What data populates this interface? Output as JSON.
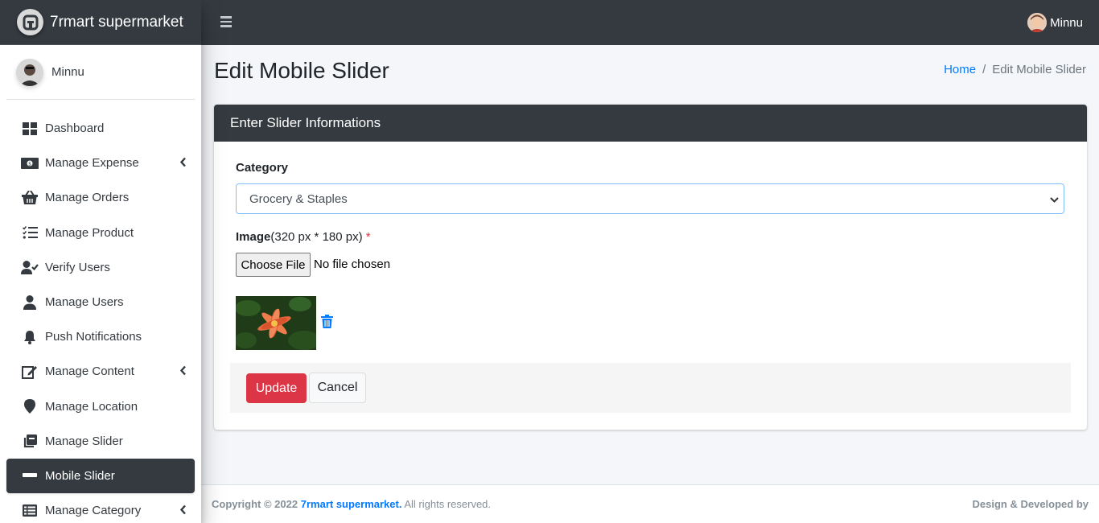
{
  "brand": {
    "name": "7rmart supermarket"
  },
  "sidebar": {
    "user_name": "Minnu",
    "items": [
      {
        "label": "Dashboard",
        "icon": "dashboard-icon"
      },
      {
        "label": "Manage Expense",
        "icon": "money-icon"
      },
      {
        "label": "Manage Orders",
        "icon": "basket-icon"
      },
      {
        "label": "Manage Product",
        "icon": "tasks-icon"
      },
      {
        "label": "Verify Users",
        "icon": "user-check-icon"
      },
      {
        "label": "Manage Users",
        "icon": "user-icon"
      },
      {
        "label": "Push Notifications",
        "icon": "bell-icon"
      },
      {
        "label": "Manage Content",
        "icon": "edit-icon"
      },
      {
        "label": "Manage Location",
        "icon": "map-marker-icon"
      },
      {
        "label": "Manage Slider",
        "icon": "clone-icon"
      },
      {
        "label": "Mobile Slider",
        "icon": "minus-icon"
      },
      {
        "label": "Manage Category",
        "icon": "list-icon"
      }
    ]
  },
  "topbar": {
    "user_name": "Minnu"
  },
  "header": {
    "title": "Edit Mobile Slider",
    "breadcrumb": {
      "home": "Home",
      "separator": "/",
      "current": "Edit Mobile Slider"
    }
  },
  "form": {
    "card_title": "Enter Slider Informations",
    "category_label": "Category",
    "category_value": "Grocery & Staples",
    "image_label": "Image",
    "image_hint": "(320 px * 180 px)",
    "required_mark": "*",
    "file_button": "Choose File",
    "file_status": "No file chosen",
    "update_label": "Update",
    "cancel_label": "Cancel"
  },
  "footer": {
    "copyright": "Copyright © 2022",
    "brand_link": "7rmart supermarket.",
    "rights": "All rights reserved.",
    "designed": "Design & Developed by"
  },
  "colors": {
    "dark": "#343a40",
    "primary": "#007bff",
    "danger": "#dc3545",
    "background": "#f4f6f9"
  }
}
